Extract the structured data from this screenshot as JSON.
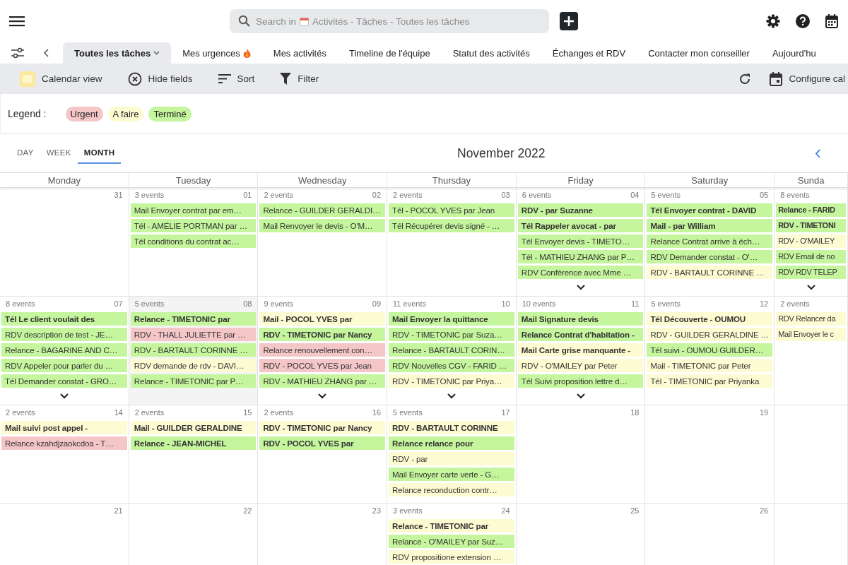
{
  "search": {
    "prefix": "Search in",
    "placeholder": "Activités - Tâches - Toutes les tâches"
  },
  "tabs": [
    {
      "label": "Toutes les tâches",
      "selected": true,
      "caret": true
    },
    {
      "label": "Mes urgences",
      "selected": false,
      "flame": true
    },
    {
      "label": "Mes activités",
      "selected": false
    },
    {
      "label": "Timeline de l'équipe",
      "selected": false
    },
    {
      "label": "Statut des activités",
      "selected": false
    },
    {
      "label": "Échanges et RDV",
      "selected": false
    },
    {
      "label": "Contacter mon conseiller",
      "selected": false
    },
    {
      "label": "Aujourd'hu",
      "selected": false
    }
  ],
  "toolbar": {
    "left": [
      {
        "kind": "calendar",
        "label": "Calendar view"
      },
      {
        "kind": "hide",
        "label": "Hide fields"
      },
      {
        "kind": "sort",
        "label": "Sort"
      },
      {
        "kind": "filter",
        "label": "Filter"
      }
    ],
    "configure": "Configure cal"
  },
  "legend": {
    "label": "Legend :",
    "items": [
      {
        "label": "Urgent",
        "color": "#f5c6c8"
      },
      {
        "label": "A faire",
        "color": "#fdfbd2"
      },
      {
        "label": "Terminé",
        "color": "#c5f59d"
      }
    ]
  },
  "views": [
    {
      "label": "DAY",
      "selected": false
    },
    {
      "label": "WEEK",
      "selected": false
    },
    {
      "label": "MONTH",
      "selected": true
    }
  ],
  "month": "November 2022",
  "weekdays": [
    "Monday",
    "Tuesday",
    "Wednesday",
    "Thursday",
    "Friday",
    "Saturday",
    "Sunda"
  ],
  "weeks": [
    {
      "days": [
        {
          "date": "31"
        },
        {
          "date": "01",
          "count": "3 events",
          "events": [
            {
              "text": "Mail Envoyer contrat par em…",
              "color": "#c5f59d"
            },
            {
              "text": "Tél - AMÉLIE PORTMAN par …",
              "color": "#c5f59d"
            },
            {
              "text": "Tél conditions du contrat ac…",
              "color": "#c5f59d"
            }
          ]
        },
        {
          "date": "02",
          "count": "2 events",
          "events": [
            {
              "text": "Relance - GUILDER GERALDI…",
              "color": "#c5f59d"
            },
            {
              "text": "Mail Renvoyer le devis - O'M…",
              "color": "#c5f59d"
            }
          ]
        },
        {
          "date": "03",
          "count": "2 events",
          "events": [
            {
              "text": "Tél - POCOL YVES par Jean",
              "color": "#c5f59d"
            },
            {
              "text": "Tél Récupérer devis signé - …",
              "color": "#c5f59d"
            }
          ]
        },
        {
          "date": "04",
          "count": "6 events",
          "more": true,
          "events": [
            {
              "text": "RDV - par Suzanne",
              "color": "#c5f59d",
              "bold": true
            },
            {
              "text": "Tél Rappeler avocat - par",
              "color": "#c5f59d",
              "bold": true
            },
            {
              "text": "Tél Envoyer devis - TIMETO…",
              "color": "#c5f59d"
            },
            {
              "text": "Tél - MATHIEU ZHANG par P…",
              "color": "#c5f59d"
            },
            {
              "text": "RDV Conférence avec Mme …",
              "color": "#c5f59d"
            }
          ]
        },
        {
          "date": "05",
          "count": "5 events",
          "events": [
            {
              "text": "Tél Envoyer contrat - DAVID",
              "color": "#c5f59d",
              "bold": true
            },
            {
              "text": "Mail - par William",
              "color": "#c5f59d",
              "bold": true
            },
            {
              "text": "Relance Contrat arrive à éch…",
              "color": "#c5f59d"
            },
            {
              "text": "RDV Demander constat - O'…",
              "color": "#c5f59d"
            },
            {
              "text": "RDV - BARTAULT CORINNE …",
              "color": "#fdfbd2"
            }
          ]
        },
        {
          "count": "8 events",
          "more": true,
          "events": [
            {
              "text": "Relance - FARID",
              "color": "#c5f59d",
              "bold": true
            },
            {
              "text": "RDV - TIMETONI",
              "color": "#c5f59d",
              "bold": true
            },
            {
              "text": "RDV - O'MAILEY",
              "color": "#fdfbd2"
            },
            {
              "text": "RDV Email de no",
              "color": "#c5f59d"
            },
            {
              "text": "RDV RDV TELEP",
              "color": "#c5f59d"
            }
          ]
        }
      ]
    },
    {
      "days": [
        {
          "date": "07",
          "count": "8 events",
          "more": true,
          "events": [
            {
              "text": "Tél Le client voulait des",
              "color": "#c5f59d",
              "bold": true
            },
            {
              "text": "RDV description de test - JE…",
              "color": "#c5f59d"
            },
            {
              "text": "Relance - BAGARINE AND C…",
              "color": "#c5f59d"
            },
            {
              "text": "RDV Appeler pour parler du …",
              "color": "#c5f59d"
            },
            {
              "text": "Tél Demander constat - GRO…",
              "color": "#c5f59d"
            }
          ]
        },
        {
          "date": "08",
          "count": "5 events",
          "highlighted": true,
          "events": [
            {
              "text": "Relance - TIMETONIC par",
              "color": "#c5f59d",
              "bold": true
            },
            {
              "text": "RDV - THALL JULIETTE par …",
              "color": "#f5c6c8"
            },
            {
              "text": "RDV - BARTAULT CORINNE …",
              "color": "#c5f59d"
            },
            {
              "text": "RDV demande de rdv - DAVI…",
              "color": "#fdfbd2"
            },
            {
              "text": "Relance - TIMETONIC par P…",
              "color": "#c5f59d"
            }
          ]
        },
        {
          "date": "09",
          "count": "9 events",
          "more": true,
          "events": [
            {
              "text": "Mail - POCOL YVES par",
              "color": "#fdfbd2",
              "bold": true
            },
            {
              "text": "RDV - TIMETONIC par Nancy",
              "color": "#c5f59d",
              "bold": true
            },
            {
              "text": "Relance renouvellement con…",
              "color": "#f5c6c8"
            },
            {
              "text": "RDV - POCOL YVES par Jean",
              "color": "#f5c6c8"
            },
            {
              "text": "RDV - MATHIEU ZHANG par …",
              "color": "#c5f59d"
            }
          ]
        },
        {
          "date": "10",
          "count": "11 events",
          "more": true,
          "events": [
            {
              "text": "Mail Envoyer la quittance",
              "color": "#c5f59d",
              "bold": true
            },
            {
              "text": "RDV - TIMETONIC par Suza…",
              "color": "#c5f59d"
            },
            {
              "text": "Relance - BARTAULT CORIN…",
              "color": "#c5f59d"
            },
            {
              "text": "RDV Nouvelles CGV - FARID …",
              "color": "#c5f59d"
            },
            {
              "text": "RDV - TIMETONIC par Priya…",
              "color": "#fdfbd2"
            }
          ]
        },
        {
          "date": "11",
          "count": "10 events",
          "more": true,
          "events": [
            {
              "text": "Mail Signature devis",
              "color": "#c5f59d",
              "bold": true
            },
            {
              "text": "Relance Contrat d'habitation -",
              "color": "#c5f59d",
              "bold": true
            },
            {
              "text": "Mail Carte grise manquante -",
              "color": "#fdfbd2",
              "bold": true
            },
            {
              "text": "RDV - O'MAILEY par Peter",
              "color": "#fdfbd2"
            },
            {
              "text": "Tél Suivi proposition lettre d…",
              "color": "#c5f59d"
            }
          ]
        },
        {
          "date": "12",
          "count": "5 events",
          "events": [
            {
              "text": "Tél Découverte - OUMOU",
              "color": "#fdfbd2",
              "bold": true
            },
            {
              "text": "RDV - GUILDER GERALDINE …",
              "color": "#fdfbd2"
            },
            {
              "text": "Tél suivi - OUMOU GUILDER…",
              "color": "#c5f59d"
            },
            {
              "text": "Mail - TIMETONIC par Peter",
              "color": "#fdfbd2"
            },
            {
              "text": "Tél - TIMETONIC par Priyanka",
              "color": "#fdfbd2"
            }
          ]
        },
        {
          "count": "2 events",
          "events": [
            {
              "text": "RDV Relancer da",
              "color": "#fdfbd2"
            },
            {
              "text": "Mail Envoyer le c",
              "color": "#fdfbd2"
            }
          ]
        }
      ]
    },
    {
      "days": [
        {
          "date": "14",
          "count": "2 events",
          "events": [
            {
              "text": "Mail suivi post appel -",
              "color": "#fdfbd2",
              "bold": true
            },
            {
              "text": "Relance kzahdjzaokcdoa - T…",
              "color": "#f5c6c8"
            }
          ]
        },
        {
          "date": "15",
          "count": "2 events",
          "events": [
            {
              "text": "Mail - GUILDER GERALDINE",
              "color": "#fdfbd2",
              "bold": true
            },
            {
              "text": "Relance - JEAN-MICHEL",
              "color": "#c5f59d",
              "bold": true
            }
          ]
        },
        {
          "date": "16",
          "count": "2 events",
          "events": [
            {
              "text": "RDV - TIMETONIC par Nancy",
              "color": "#fdfbd2",
              "bold": true
            },
            {
              "text": "RDV - POCOL YVES par",
              "color": "#c5f59d",
              "bold": true
            }
          ]
        },
        {
          "date": "17",
          "count": "5 events",
          "events": [
            {
              "text": "RDV - BARTAULT CORINNE",
              "color": "#fdfbd2",
              "bold": true
            },
            {
              "text": "Relance relance pour",
              "color": "#c5f59d",
              "bold": true
            },
            {
              "text": "RDV - par",
              "color": "#fdfbd2"
            },
            {
              "text": "Mail Envoyer carte verte - G…",
              "color": "#c5f59d"
            },
            {
              "text": "Relance reconduction contr…",
              "color": "#fdfbd2"
            }
          ]
        },
        {
          "date": "18"
        },
        {
          "date": "19"
        }
      ]
    },
    {
      "days": [
        {
          "date": "21"
        },
        {
          "date": "22"
        },
        {
          "date": "23"
        },
        {
          "date": "24",
          "count": "3 events",
          "events": [
            {
              "text": "Relance - TIMETONIC par",
              "color": "#fdfbd2",
              "bold": true
            },
            {
              "text": "Relance - O'MAILEY par Suz…",
              "color": "#c5f59d"
            },
            {
              "text": "RDV propositione extension …",
              "color": "#fdfbd2"
            }
          ]
        },
        {
          "date": "25"
        },
        {
          "date": "26"
        }
      ]
    }
  ]
}
